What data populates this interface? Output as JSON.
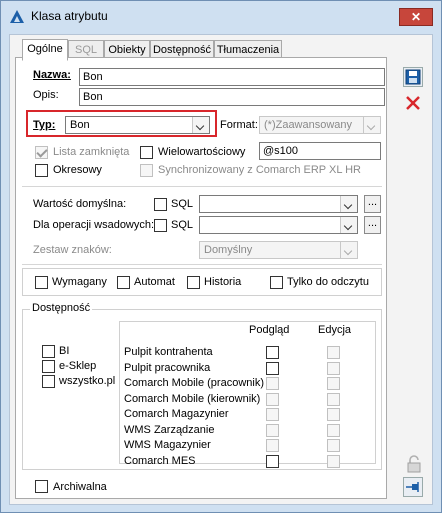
{
  "window": {
    "title": "Klasa atrybutu",
    "close_glyph": "✕"
  },
  "tabs": [
    {
      "label": "Ogólne",
      "state": "active"
    },
    {
      "label": "SQL",
      "state": "disabled"
    },
    {
      "label": "Obiekty",
      "state": "normal"
    },
    {
      "label": "Dostępność",
      "state": "normal"
    },
    {
      "label": "Tłumaczenia",
      "state": "normal"
    }
  ],
  "form": {
    "nazwa_label": "Nazwa:",
    "nazwa_value": "Bon",
    "opis_label": "Opis:",
    "opis_value": "Bon",
    "typ_label": "Typ:",
    "typ_value": "Bon",
    "format_label": "Format:",
    "format_value": "(*)Zaawansowany",
    "lista_zamknieta_label": "Lista zamknięta",
    "lista_zamknieta_checked": true,
    "wielowartosciowy_label": "Wielowartościowy",
    "wielowartosciowy_checked": false,
    "mask_value": "@s100",
    "okresowy_label": "Okresowy",
    "okresowy_checked": false,
    "sync_label": "Synchronizowany z Comarch ERP XL HR",
    "sync_checked": false,
    "wartosc_domyslna_label": "Wartość domyślna:",
    "dla_operacji_label": "Dla operacji wsadowych:",
    "sql_label": "SQL",
    "dots_label": "...",
    "zestaw_znakow_label": "Zestaw znaków:",
    "zestaw_znakow_value": "Domyślny"
  },
  "flags": {
    "wymagany": "Wymagany",
    "automat": "Automat",
    "historia": "Historia",
    "tylko_do_odczytu": "Tylko do odczytu"
  },
  "dostepnosc": {
    "title": "Dostępność",
    "left_items": [
      "BI",
      "e-Sklep",
      "wszystko.pl"
    ],
    "col_podglad": "Podgląd",
    "col_edycja": "Edycja",
    "rows": [
      {
        "name": "Pulpit kontrahenta",
        "podglad_active": true
      },
      {
        "name": "Pulpit pracownika",
        "podglad_active": true
      },
      {
        "name": "Comarch Mobile (pracownik)",
        "podglad_active": false
      },
      {
        "name": "Comarch Mobile (kierownik)",
        "podglad_active": false
      },
      {
        "name": "Comarch Magazynier",
        "podglad_active": false
      },
      {
        "name": "WMS Zarządzanie",
        "podglad_active": false
      },
      {
        "name": "WMS Magazynier",
        "podglad_active": false
      },
      {
        "name": "Comarch MES",
        "podglad_active": true
      }
    ]
  },
  "archiwalna_label": "Archiwalna",
  "side_buttons": {
    "save_icon": "save-icon",
    "cancel_icon": "cancel-icon",
    "lock_icon": "lock-icon",
    "pin_icon": "pin-icon"
  },
  "colors": {
    "highlight": "#d8262b",
    "title_bg": "#cfe0f1",
    "save_blue": "#1c5fa8",
    "cancel_red": "#d8262b"
  }
}
